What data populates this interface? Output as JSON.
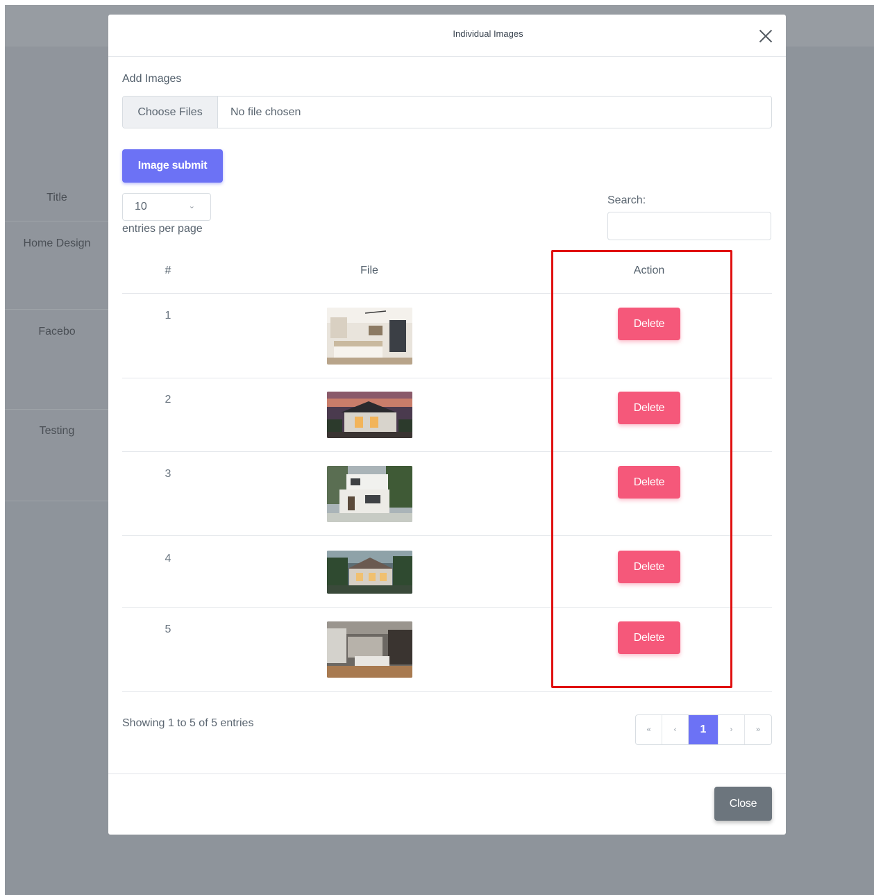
{
  "background_table": {
    "header": "Title",
    "rows": [
      "Home Design",
      "Facebo",
      "Testing"
    ]
  },
  "modal": {
    "title": "Individual Images",
    "add_images_label": "Add Images",
    "file_input": {
      "button_label": "Choose Files",
      "status_text": "No file chosen"
    },
    "submit_label": "Image submit",
    "entries": {
      "selected": "10",
      "label": "entries per page"
    },
    "search": {
      "label": "Search:",
      "value": ""
    },
    "table": {
      "headers": [
        "#",
        "File",
        "Action"
      ],
      "rows": [
        {
          "index": "1",
          "image": "bedroom-interior",
          "action": "Delete"
        },
        {
          "index": "2",
          "image": "house-exterior-dusk",
          "action": "Delete"
        },
        {
          "index": "3",
          "image": "modern-white-house",
          "action": "Delete"
        },
        {
          "index": "4",
          "image": "villa-exterior",
          "action": "Delete"
        },
        {
          "index": "5",
          "image": "living-room-interior",
          "action": "Delete"
        }
      ]
    },
    "showing_text": "Showing 1 to 5 of 5 entries",
    "pagination": {
      "first": "«",
      "prev": "‹",
      "current": "1",
      "next": "›",
      "last": "»"
    },
    "close_label": "Close"
  },
  "colors": {
    "primary": "#6c72f5",
    "danger": "#f5587a",
    "secondary": "#6c757d",
    "highlight": "#e01010",
    "backdrop": "#8e949b"
  }
}
